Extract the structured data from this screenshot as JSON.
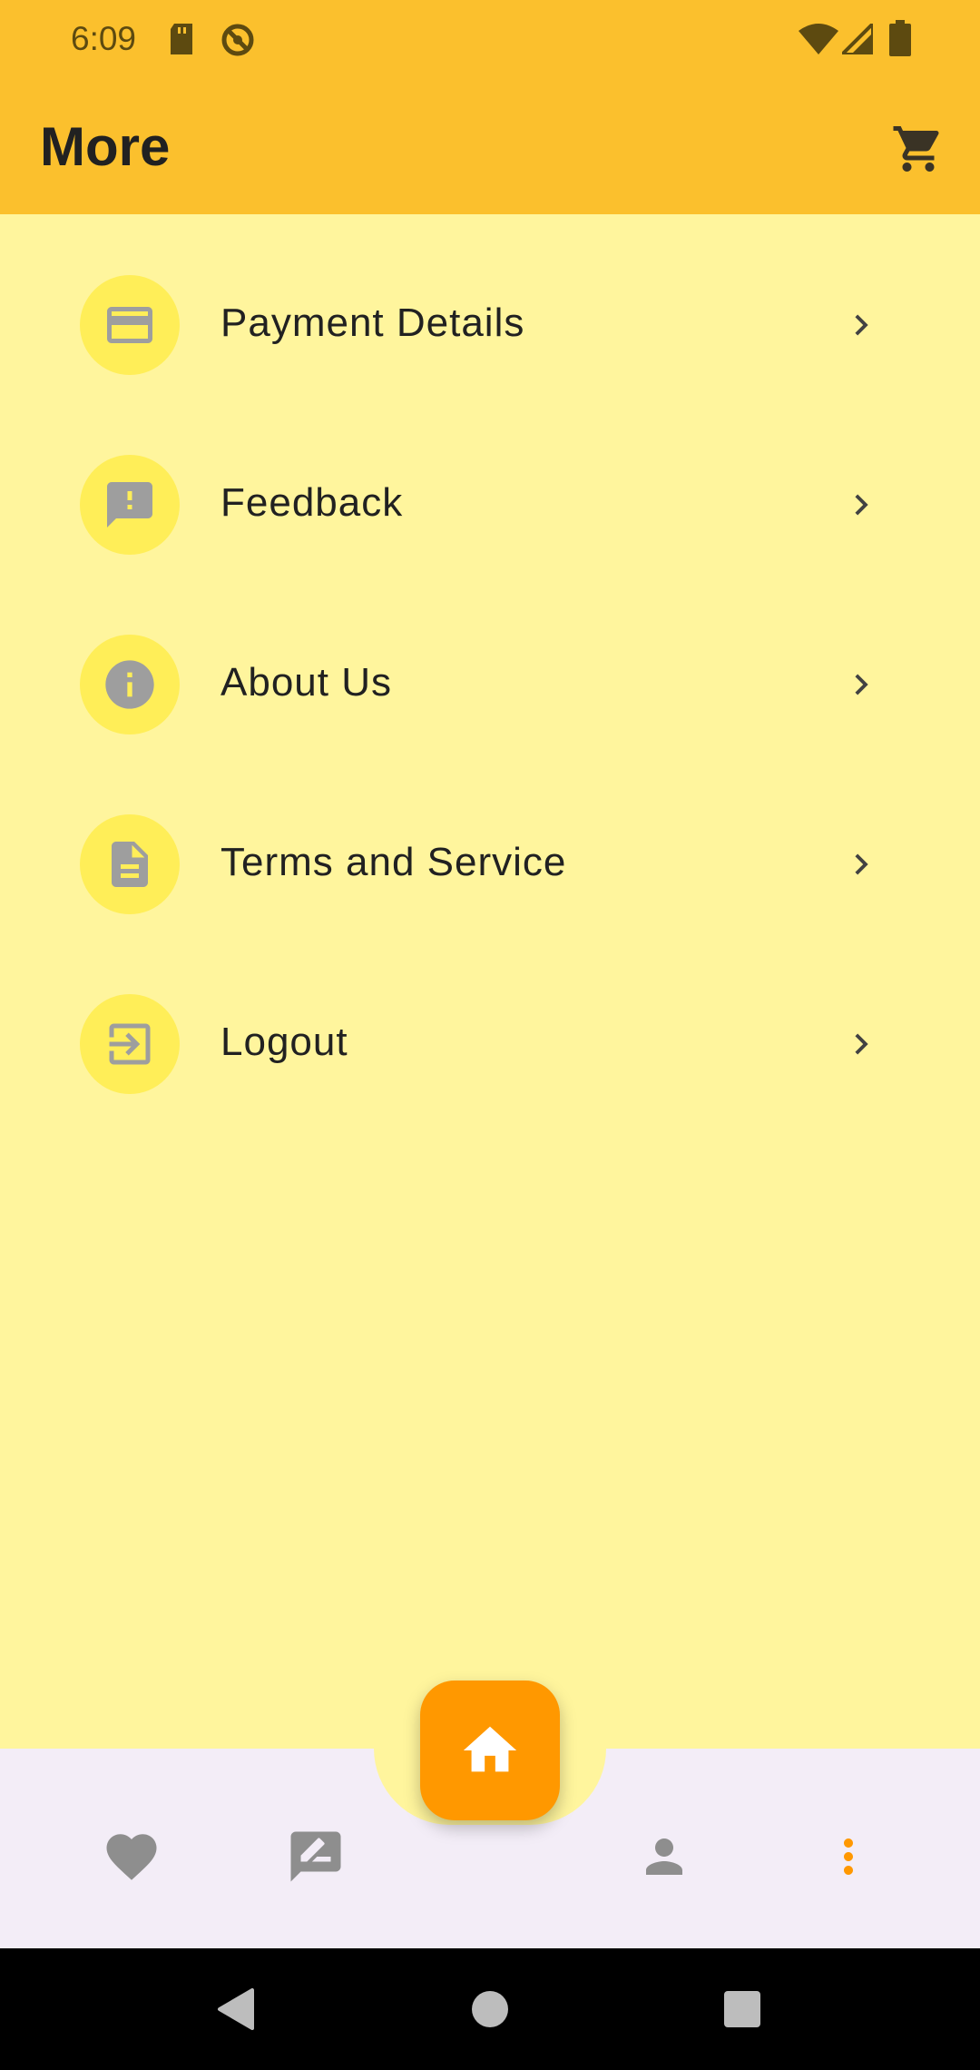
{
  "status_bar": {
    "time": "6:09",
    "left_icons": [
      "sd-card-icon",
      "no-sync-icon"
    ],
    "right_icons": [
      "wifi-icon",
      "cellular-signal-icon",
      "battery-icon"
    ]
  },
  "app_bar": {
    "title": "More",
    "action_icon": "cart-icon"
  },
  "menu": {
    "items": [
      {
        "label": "Payment Details",
        "icon": "credit-card-icon"
      },
      {
        "label": "Feedback",
        "icon": "feedback-icon"
      },
      {
        "label": "About Us",
        "icon": "info-icon"
      },
      {
        "label": "Terms and Service",
        "icon": "document-icon"
      },
      {
        "label": "Logout",
        "icon": "logout-icon"
      }
    ]
  },
  "bottom_nav": {
    "items": [
      {
        "name": "favorites",
        "icon": "heart-icon"
      },
      {
        "name": "reviews",
        "icon": "rate-review-icon"
      },
      {
        "name": "home",
        "icon": "home-icon"
      },
      {
        "name": "profile",
        "icon": "person-icon"
      },
      {
        "name": "more",
        "icon": "more-vertical-icon",
        "active": true
      }
    ]
  },
  "colors": {
    "app_bar": "#FBC02D",
    "background": "#FFF59D",
    "icon_circle": "#FFEE58",
    "fab": "#FF9800",
    "bottom_nav": "#F3EDF7",
    "active_nav": "#FF9800"
  }
}
